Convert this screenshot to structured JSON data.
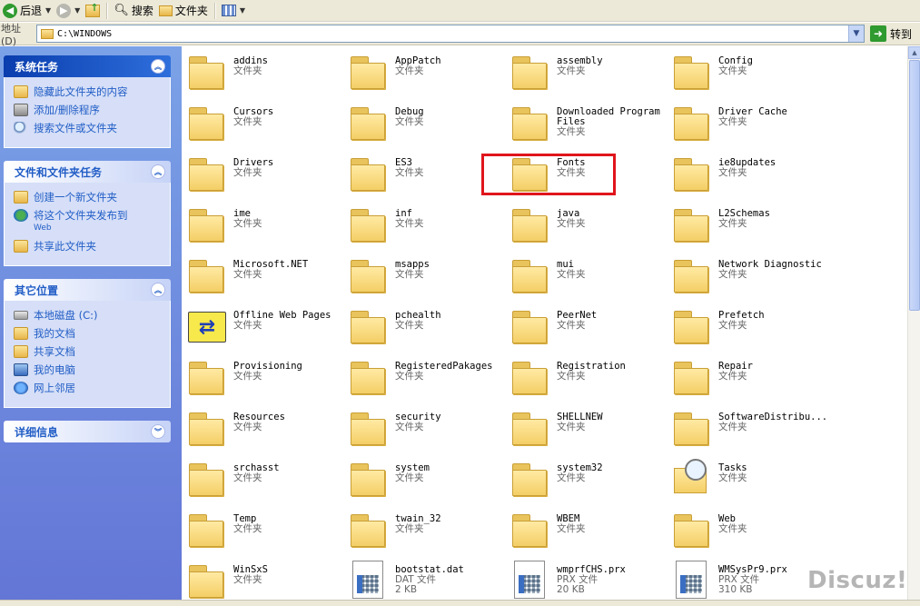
{
  "toolbar": {
    "back_label": "后退",
    "search_label": "搜索",
    "folders_label": "文件夹"
  },
  "address": {
    "label": "地址(D)",
    "path": "C:\\WINDOWS",
    "go_label": "转到"
  },
  "left_pane": {
    "system_tasks": {
      "title": "系统任务",
      "items": [
        {
          "label": "隐藏此文件夹的内容",
          "icon": "folder-icon"
        },
        {
          "label": "添加/删除程序",
          "icon": "add-remove-icon"
        },
        {
          "label": "搜索文件或文件夹",
          "icon": "search-icon"
        }
      ]
    },
    "file_tasks": {
      "title": "文件和文件夹任务",
      "items": [
        {
          "label": "创建一个新文件夹",
          "icon": "new-folder-icon"
        },
        {
          "label": "将这个文件夹发布到",
          "sub": "Web",
          "icon": "globe-icon"
        },
        {
          "label": "共享此文件夹",
          "icon": "share-icon"
        }
      ]
    },
    "other_places": {
      "title": "其它位置",
      "items": [
        {
          "label": "本地磁盘 (C:)",
          "icon": "drive-icon"
        },
        {
          "label": "我的文档",
          "icon": "folder-icon"
        },
        {
          "label": "共享文档",
          "icon": "folder-icon"
        },
        {
          "label": "我的电脑",
          "icon": "computer-icon"
        },
        {
          "label": "网上邻居",
          "icon": "network-icon"
        }
      ]
    },
    "details": {
      "title": "详细信息"
    }
  },
  "files": [
    {
      "name": "addins",
      "type": "文件夹"
    },
    {
      "name": "AppPatch",
      "type": "文件夹"
    },
    {
      "name": "assembly",
      "type": "文件夹"
    },
    {
      "name": "Config",
      "type": "文件夹"
    },
    {
      "name": "Cursors",
      "type": "文件夹"
    },
    {
      "name": "Debug",
      "type": "文件夹"
    },
    {
      "name": "Downloaded Program\nFiles",
      "type": "文件夹"
    },
    {
      "name": "Driver Cache",
      "type": "文件夹"
    },
    {
      "name": "Drivers",
      "type": "文件夹"
    },
    {
      "name": "ES3",
      "type": "文件夹"
    },
    {
      "name": "Fonts",
      "type": "文件夹"
    },
    {
      "name": "ie8updates",
      "type": "文件夹"
    },
    {
      "name": "ime",
      "type": "文件夹"
    },
    {
      "name": "inf",
      "type": "文件夹"
    },
    {
      "name": "java",
      "type": "文件夹"
    },
    {
      "name": "L2Schemas",
      "type": "文件夹"
    },
    {
      "name": "Microsoft.NET",
      "type": "文件夹"
    },
    {
      "name": "msapps",
      "type": "文件夹"
    },
    {
      "name": "mui",
      "type": "文件夹"
    },
    {
      "name": "Network Diagnostic",
      "type": "文件夹"
    },
    {
      "name": "Offline Web Pages",
      "type": "文件夹"
    },
    {
      "name": "pchealth",
      "type": "文件夹"
    },
    {
      "name": "PeerNet",
      "type": "文件夹"
    },
    {
      "name": "Prefetch",
      "type": "文件夹"
    },
    {
      "name": "Provisioning",
      "type": "文件夹"
    },
    {
      "name": "RegisteredPakages",
      "type": "文件夹"
    },
    {
      "name": "Registration",
      "type": "文件夹"
    },
    {
      "name": "Repair",
      "type": "文件夹"
    },
    {
      "name": "Resources",
      "type": "文件夹"
    },
    {
      "name": "security",
      "type": "文件夹"
    },
    {
      "name": "SHELLNEW",
      "type": "文件夹"
    },
    {
      "name": "SoftwareDistribu...",
      "type": "文件夹"
    },
    {
      "name": "srchasst",
      "type": "文件夹"
    },
    {
      "name": "system",
      "type": "文件夹"
    },
    {
      "name": "system32",
      "type": "文件夹"
    },
    {
      "name": "Tasks",
      "type": "文件夹"
    },
    {
      "name": "Temp",
      "type": "文件夹"
    },
    {
      "name": "twain_32",
      "type": "文件夹"
    },
    {
      "name": "WBEM",
      "type": "文件夹"
    },
    {
      "name": "Web",
      "type": "文件夹"
    },
    {
      "name": "WinSxS",
      "type": "文件夹"
    },
    {
      "name": "bootstat.dat",
      "type": "DAT 文件",
      "size": "2 KB"
    },
    {
      "name": "wmprfCHS.prx",
      "type": "PRX 文件",
      "size": "20 KB"
    },
    {
      "name": "WMSysPr9.prx",
      "type": "PRX 文件",
      "size": "310 KB"
    }
  ],
  "watermark": "Discuz!",
  "colors": {
    "highlight_box": "#e0151c",
    "panel_title": "#215dc6",
    "sidebar_bg": "#6f8de0"
  }
}
